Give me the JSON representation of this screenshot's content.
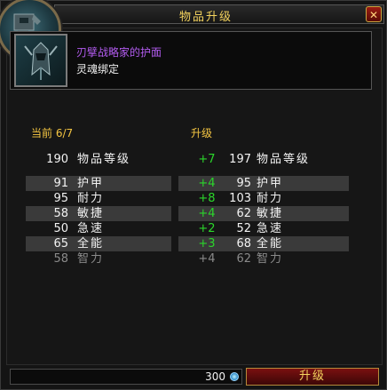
{
  "window": {
    "title": "物品升级",
    "close_label": "✕"
  },
  "item": {
    "name": "刃擘战略家的护面",
    "binding": "灵魂绑定"
  },
  "columns": {
    "current_label": "当前 6/7",
    "upgrade_label": "升级"
  },
  "stats": [
    {
      "current": "190",
      "label": "物品等级",
      "delta": "+7",
      "new": "197",
      "label2": "物品等级"
    },
    {
      "current": "91",
      "label": "护甲",
      "delta": "+4",
      "new": "95",
      "label2": "护甲"
    },
    {
      "current": "95",
      "label": "耐力",
      "delta": "+8",
      "new": "103",
      "label2": "耐力"
    },
    {
      "current": "58",
      "label": "敏捷",
      "delta": "+4",
      "new": "62",
      "label2": "敏捷"
    },
    {
      "current": "50",
      "label": "急速",
      "delta": "+2",
      "new": "52",
      "label2": "急速"
    },
    {
      "current": "65",
      "label": "全能",
      "delta": "+3",
      "new": "68",
      "label2": "全能"
    },
    {
      "current": "58",
      "label": "智力",
      "delta": "+4",
      "new": "62",
      "label2": "智力"
    }
  ],
  "footer": {
    "currency_amount": "300",
    "upgrade_button": "升级"
  },
  "colors": {
    "title_gold": "#f4d35e",
    "epic_purple": "#b35cf0",
    "positive_green": "#2bd62b",
    "button_red": "#7a1010"
  },
  "icons": {
    "portrait": "helmet-portrait-icon",
    "item": "helmet-item-icon",
    "currency": "valorstone-gem-icon",
    "close": "close-icon"
  }
}
